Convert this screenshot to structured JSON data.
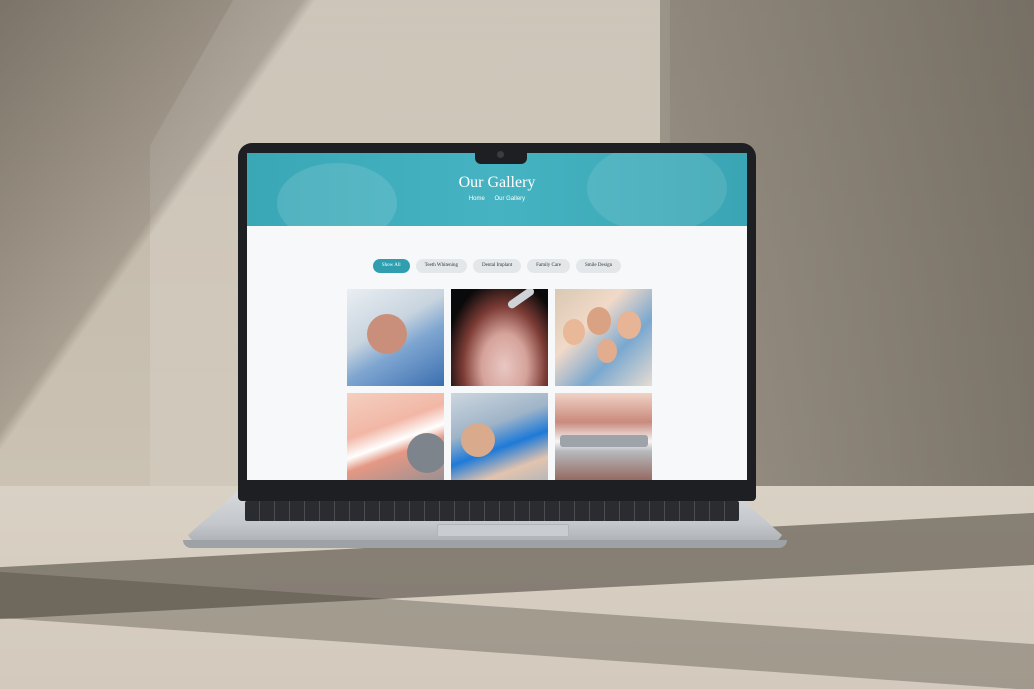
{
  "page": {
    "hero_title": "Our Gallery",
    "breadcrumb": {
      "home": "Home",
      "current": "Our Gallery"
    }
  },
  "filters": [
    {
      "label": "Show All",
      "active": true
    },
    {
      "label": "Teeth Whitening",
      "active": false
    },
    {
      "label": "Dental Implant",
      "active": false
    },
    {
      "label": "Family Care",
      "active": false
    },
    {
      "label": "Smile Design",
      "active": false
    }
  ],
  "gallery": {
    "tiles": [
      {
        "subject": "dentist-examining-patient"
      },
      {
        "subject": "dental-probe-on-teeth"
      },
      {
        "subject": "smiling-family"
      },
      {
        "subject": "smile-with-dental-tool"
      },
      {
        "subject": "child-dental-treatment"
      },
      {
        "subject": "orthodontic-braces"
      }
    ]
  },
  "colors": {
    "accent": "#2f9fb0",
    "hero": "#45b3c1",
    "pill_bg": "#e4e7ea",
    "page_bg": "#f7f8f9"
  }
}
